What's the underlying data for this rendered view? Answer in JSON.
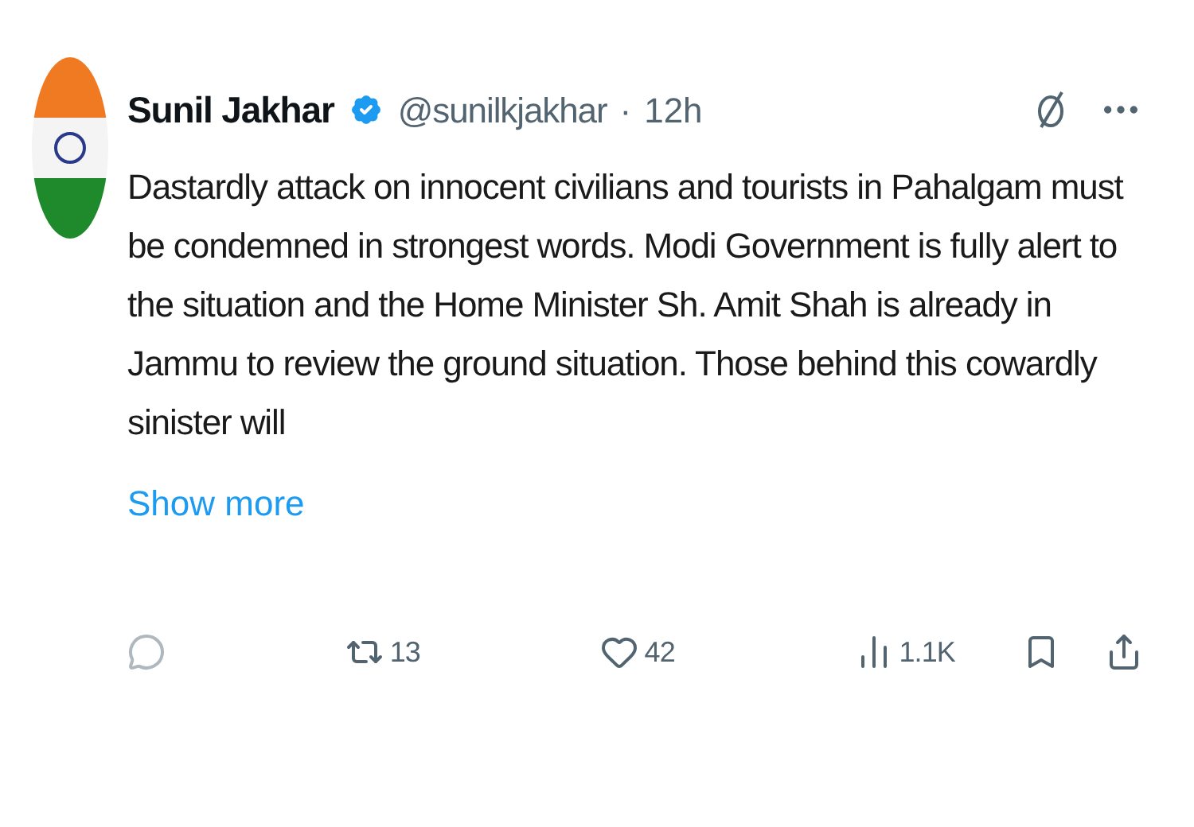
{
  "post": {
    "author": "Sunil Jakhar",
    "verified": true,
    "handle": "@sunilkjakhar",
    "separator": "·",
    "time": "12h",
    "text": "Dastardly attack on innocent civilians and tourists in Pahalgam must be condemned in strongest words. Modi Government is fully alert to the situation and the Home Minister Sh. Amit Shah is already in Jammu to review the ground situation. Those behind this cowardly sinister will",
    "show_more": "Show more",
    "actions": [
      {
        "kind": "reply"
      },
      {
        "kind": "repost",
        "count": "13"
      },
      {
        "kind": "like",
        "count": "42"
      },
      {
        "kind": "views",
        "count": "1.1K"
      }
    ]
  }
}
